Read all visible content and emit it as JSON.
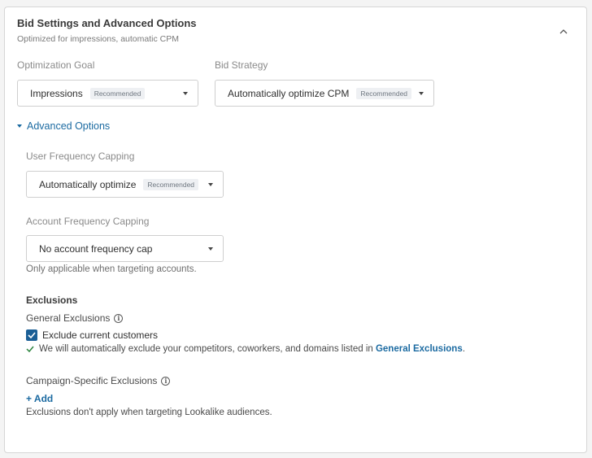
{
  "panel": {
    "title": "Bid Settings and Advanced Options",
    "subtitle": "Optimized for impressions, automatic CPM"
  },
  "optimization_goal": {
    "label": "Optimization Goal",
    "value": "Impressions",
    "badge": "Recommended"
  },
  "bid_strategy": {
    "label": "Bid Strategy",
    "value": "Automatically optimize CPM",
    "badge": "Recommended"
  },
  "advanced_toggle": "Advanced Options",
  "user_frequency": {
    "label": "User Frequency Capping",
    "value": "Automatically optimize",
    "badge": "Recommended"
  },
  "account_frequency": {
    "label": "Account Frequency Capping",
    "value": "No account frequency cap",
    "helper": "Only applicable when targeting accounts."
  },
  "exclusions": {
    "heading": "Exclusions",
    "general_label": "General Exclusions",
    "checkbox_label": "Exclude current customers",
    "checkbox_checked": true,
    "note_text": "We will automatically exclude your competitors, coworkers, and domains listed in",
    "note_link": "General Exclusions",
    "note_end": ".",
    "campaign_label": "Campaign-Specific Exclusions",
    "add_label": "+ Add",
    "footer": "Exclusions don't apply when targeting Lookalike audiences."
  },
  "icons": {
    "info": "info-icon",
    "collapse": "chevron-up-icon",
    "check": "checkmark-icon",
    "dropdown": "caret-down-icon"
  },
  "colors": {
    "link": "#1b6aa1",
    "checkbox": "#1b5f96",
    "check_mark": "#2e8540"
  }
}
